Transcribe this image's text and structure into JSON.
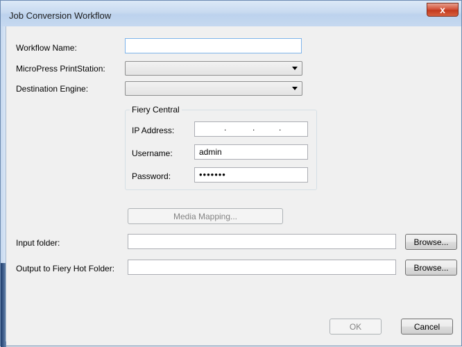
{
  "window": {
    "title": "Job Conversion Workflow",
    "close_glyph": "x"
  },
  "form": {
    "workflow_name_label": "Workflow Name:",
    "workflow_name_value": "",
    "printstation_label": "MicroPress PrintStation:",
    "printstation_value": "",
    "destination_label": "Destination Engine:",
    "destination_value": ""
  },
  "fiery_central": {
    "legend": "Fiery Central",
    "ip_label": "IP Address:",
    "ip_dots": [
      ".",
      ".",
      "."
    ],
    "username_label": "Username:",
    "username_value": "admin",
    "password_label": "Password:",
    "password_value": "•••••••"
  },
  "media_mapping_label": "Media Mapping...",
  "input_folder": {
    "label": "Input folder:",
    "value": "",
    "browse_label": "Browse..."
  },
  "output_folder": {
    "label": "Output to Fiery Hot Folder:",
    "value": "",
    "browse_label": "Browse..."
  },
  "footer": {
    "ok_label": "OK",
    "cancel_label": "Cancel"
  },
  "colors": {
    "title_bar": "#c8daf0",
    "close_button": "#c23a1f",
    "focus_border": "#7eb4ea"
  }
}
